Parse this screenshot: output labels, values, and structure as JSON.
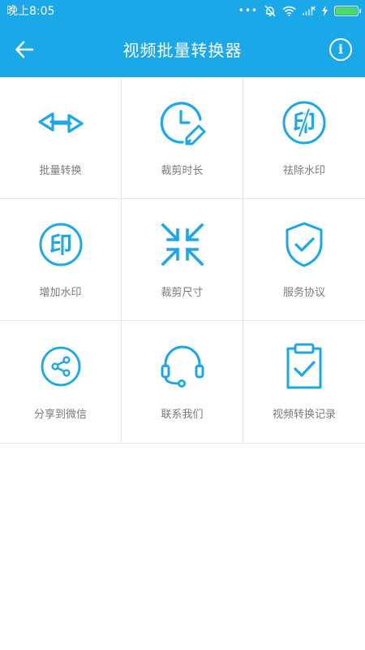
{
  "status_bar": {
    "time": "晚上8:05",
    "dots": "•••",
    "icons": [
      "bell-off-icon",
      "wifi-icon",
      "signal-icon",
      "charging-icon",
      "battery-icon"
    ],
    "battery_color": "#4cd964"
  },
  "app_bar": {
    "title": "视频批量转换器",
    "back_icon": "arrow-left-icon",
    "info_icon": "info-icon",
    "info_glyph": "i",
    "background": "#1ba8e8"
  },
  "tiles": [
    {
      "label": "批量转换",
      "icon": "swap-arrows-icon"
    },
    {
      "label": "裁剪时长",
      "icon": "clock-edit-icon"
    },
    {
      "label": "祛除水印",
      "icon": "watermark-remove-icon"
    },
    {
      "label": "增加水印",
      "icon": "watermark-add-icon"
    },
    {
      "label": "裁剪尺寸",
      "icon": "shrink-arrows-icon"
    },
    {
      "label": "服务协议",
      "icon": "shield-check-icon"
    },
    {
      "label": "分享到微信",
      "icon": "share-icon"
    },
    {
      "label": "联系我们",
      "icon": "headset-icon"
    },
    {
      "label": "视频转换记录",
      "icon": "clipboard-check-icon"
    }
  ],
  "icon_glyphs": {
    "watermark": "印"
  },
  "accent_color": "#1ba8e8"
}
